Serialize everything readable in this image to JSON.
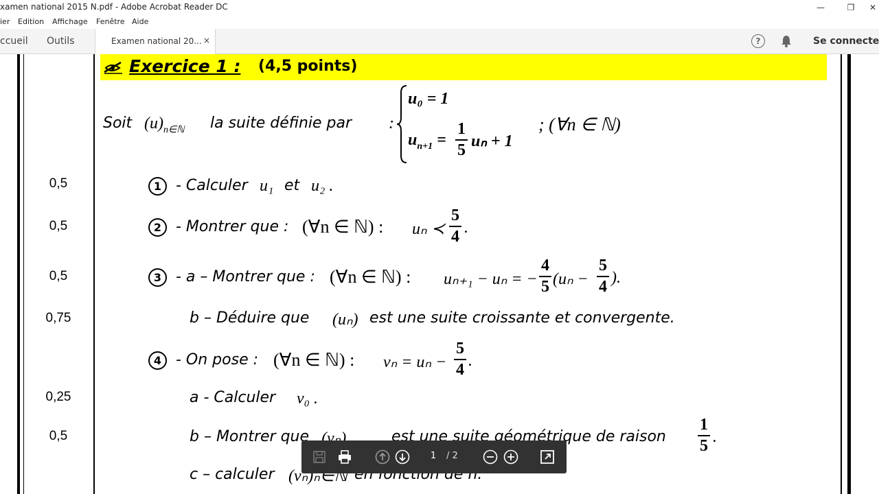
{
  "window": {
    "title": "xamen national 2015 N.pdf - Adobe Acrobat Reader DC",
    "controls": {
      "minimize": "—",
      "restore": "❐",
      "close": "✕"
    }
  },
  "menu": [
    "ier",
    "Edition",
    "Affichage",
    "Fenêtre",
    "Aide"
  ],
  "nav": {
    "home": "ccueil",
    "tools": "Outils"
  },
  "doc_tab": {
    "label": "Examen national 20...",
    "close": "×"
  },
  "header_right": {
    "help": "?",
    "signin": "Se connecter"
  },
  "exercise": {
    "title": "Exercice 1 :",
    "points": "(4,5 points)",
    "intro": "Soit",
    "intro_seq": "(u",
    "intro_sub": "n∈ℕ",
    "intro_rest": "la suite définie par",
    "def_u0": "u₀ = 1",
    "def_rec_left": "u",
    "def_rec_sub": "n+1",
    "def_rec_eq": "=",
    "def_rec_frac_num": "1",
    "def_rec_frac_den": "5",
    "def_rec_right": "uₙ + 1",
    "def_quant": "; (∀n ∈ ℕ)",
    "q1": {
      "num": "1",
      "score": "0,5",
      "text": "- Calculer",
      "math1": "u₁",
      "and": "et",
      "math2": "u₂ ."
    },
    "q2": {
      "num": "2",
      "score": "0,5",
      "text": "- Montrer que :",
      "quant": "(∀n ∈ ℕ)  :",
      "math": "uₙ ≺",
      "frac_num": "5",
      "frac_den": "4",
      "end": "."
    },
    "q3a": {
      "num": "3",
      "score": "0,5",
      "text": "- a – Montrer que :",
      "quant": "(∀n ∈ ℕ)  :",
      "math": "uₙ₊₁ − uₙ = −",
      "frac1_num": "4",
      "frac1_den": "5",
      "math_mid": "(uₙ −",
      "frac2_num": "5",
      "frac2_den": "4",
      "end": ")."
    },
    "q3b": {
      "score": "0,75",
      "text": "b – Déduire que",
      "math": "(uₙ)",
      "rest": "est une suite croissante et convergente."
    },
    "q4": {
      "num": "4",
      "text": "- On pose :",
      "quant": "(∀n ∈ ℕ)  :",
      "math": "vₙ = uₙ −",
      "frac_num": "5",
      "frac_den": "4",
      "end": "."
    },
    "q4a": {
      "score": "0,25",
      "text": "a - Calculer",
      "math": "v₀ ."
    },
    "q4b": {
      "score": "0,5",
      "text": "b – Montrer que",
      "math": "(vₙ)",
      "rest": "est  une suite géométrique de raison",
      "frac_num": "1",
      "frac_den": "5",
      "end": "."
    },
    "q4c": {
      "text": "c – calculer",
      "math": "(vₙ)ₙ∈ℕ",
      "rest": "en fonction de n."
    }
  },
  "toolbar": {
    "page_current": "1",
    "page_total": "/ 2"
  },
  "colors": {
    "banner": "#ffff00",
    "toolbar": "#323232"
  }
}
